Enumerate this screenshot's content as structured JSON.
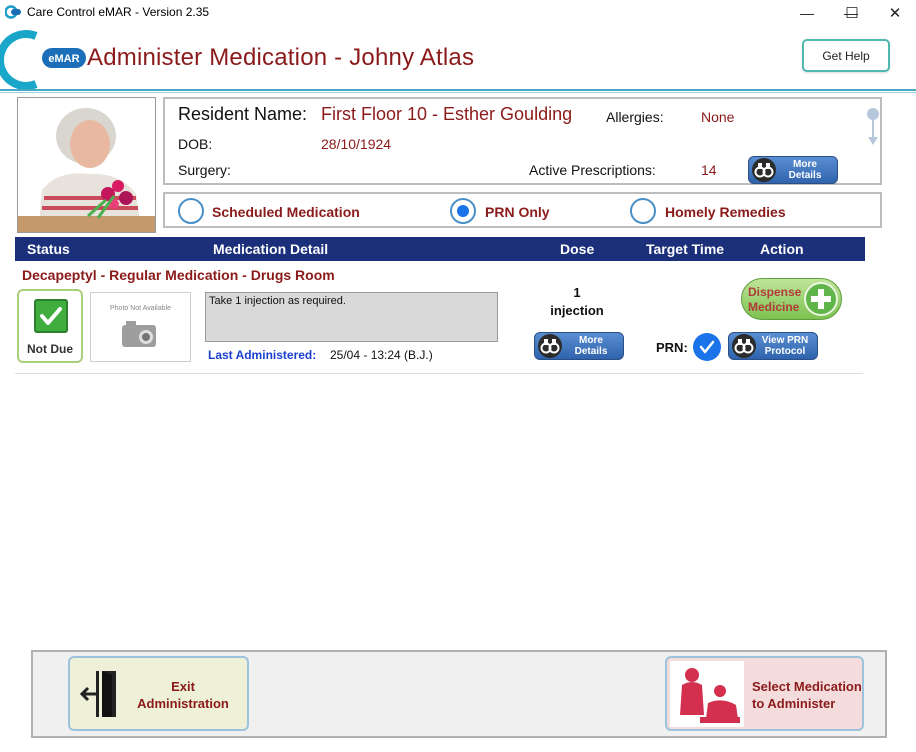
{
  "window": {
    "title": "Care Control eMAR - Version 2.35",
    "controls": {
      "minimize": "—",
      "maximize": "☐",
      "close": "✕"
    }
  },
  "header": {
    "logo_text": "eMAR",
    "title": "Administer Medication - Johny Atlas",
    "help_button": "Get Help"
  },
  "resident": {
    "name_label": "Resident Name:",
    "name": "First Floor 10 - Esther Goulding",
    "allergies_label": "Allergies:",
    "allergies": "None",
    "dob_label": "DOB:",
    "dob": "28/10/1924",
    "surgery_label": "Surgery:",
    "surgery": "",
    "active_rx_label": "Active Prescriptions:",
    "active_rx": "14",
    "more_details": "More Details"
  },
  "filter": {
    "options": [
      {
        "label": "Scheduled Medication",
        "selected": false
      },
      {
        "label": "PRN Only",
        "selected": true
      },
      {
        "label": "Homely Remedies",
        "selected": false
      }
    ]
  },
  "table": {
    "headers": [
      "Status",
      "Medication Detail",
      "Dose",
      "Target Time",
      "Action"
    ]
  },
  "medication": {
    "title": "Decapeptyl - Regular Medication - Drugs Room",
    "status": "Not Due",
    "photo_text": "Photo Not Available",
    "instructions": "Take 1 injection as required.",
    "last_admin_label": "Last Administered:",
    "last_admin_value": "25/04 - 13:24 (B.J.)",
    "dose_qty": "1",
    "dose_unit": "injection",
    "more_details": "More Details",
    "prn_label": "PRN:",
    "prn_checked": true,
    "view_prn_line1": "View PRN",
    "view_prn_line2": "Protocol",
    "dispense_line1": "Dispense",
    "dispense_line2": "Medicine"
  },
  "footer": {
    "exit_line1": "Exit",
    "exit_line2": "Administration",
    "select_line1": "Select Medication",
    "select_line2": "to Administer"
  },
  "colors": {
    "brand_red": "#8b1a1a",
    "header_navy": "#1b2f7a",
    "accent_teal": "#48a9c5",
    "button_blue": "#2f63ad",
    "status_green": "#3fae3f"
  }
}
